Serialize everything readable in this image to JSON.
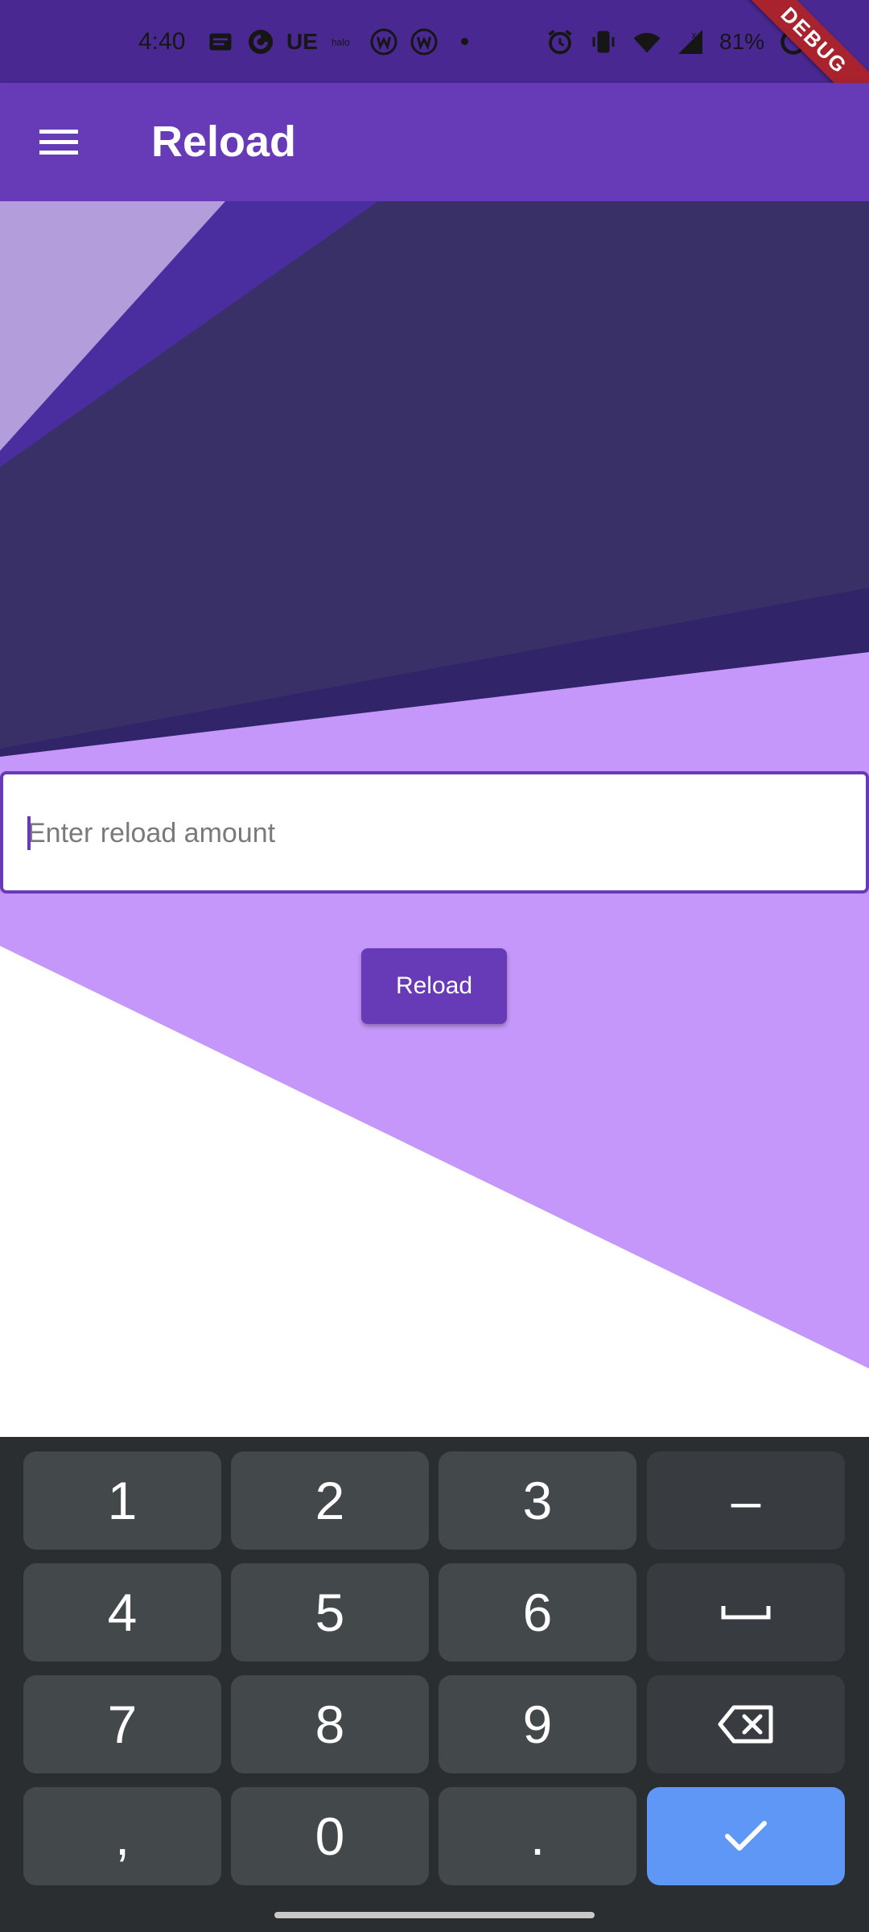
{
  "status_bar": {
    "time": "4:40",
    "notif_text": "UE",
    "battery_percent": "81%",
    "debug_banner": "DEBUG"
  },
  "app_bar": {
    "title": "Reload",
    "menu_icon": "hamburger-menu-icon"
  },
  "form": {
    "amount_placeholder": "Enter reload amount",
    "amount_value": "",
    "reload_button_label": "Reload"
  },
  "colors": {
    "primary": "#673ab7",
    "status_bar": "#4a2891",
    "light_purple": "#c597fa",
    "dark_purple": "#3a3068",
    "keyboard_bg": "#2a2e31",
    "enter_key": "#5f97f6"
  },
  "keyboard": {
    "rows": [
      [
        "1",
        "2",
        "3",
        "–"
      ],
      [
        "4",
        "5",
        "6",
        "space"
      ],
      [
        "7",
        "8",
        "9",
        "backspace"
      ],
      [
        ",",
        "0",
        ".",
        "enter"
      ]
    ]
  }
}
